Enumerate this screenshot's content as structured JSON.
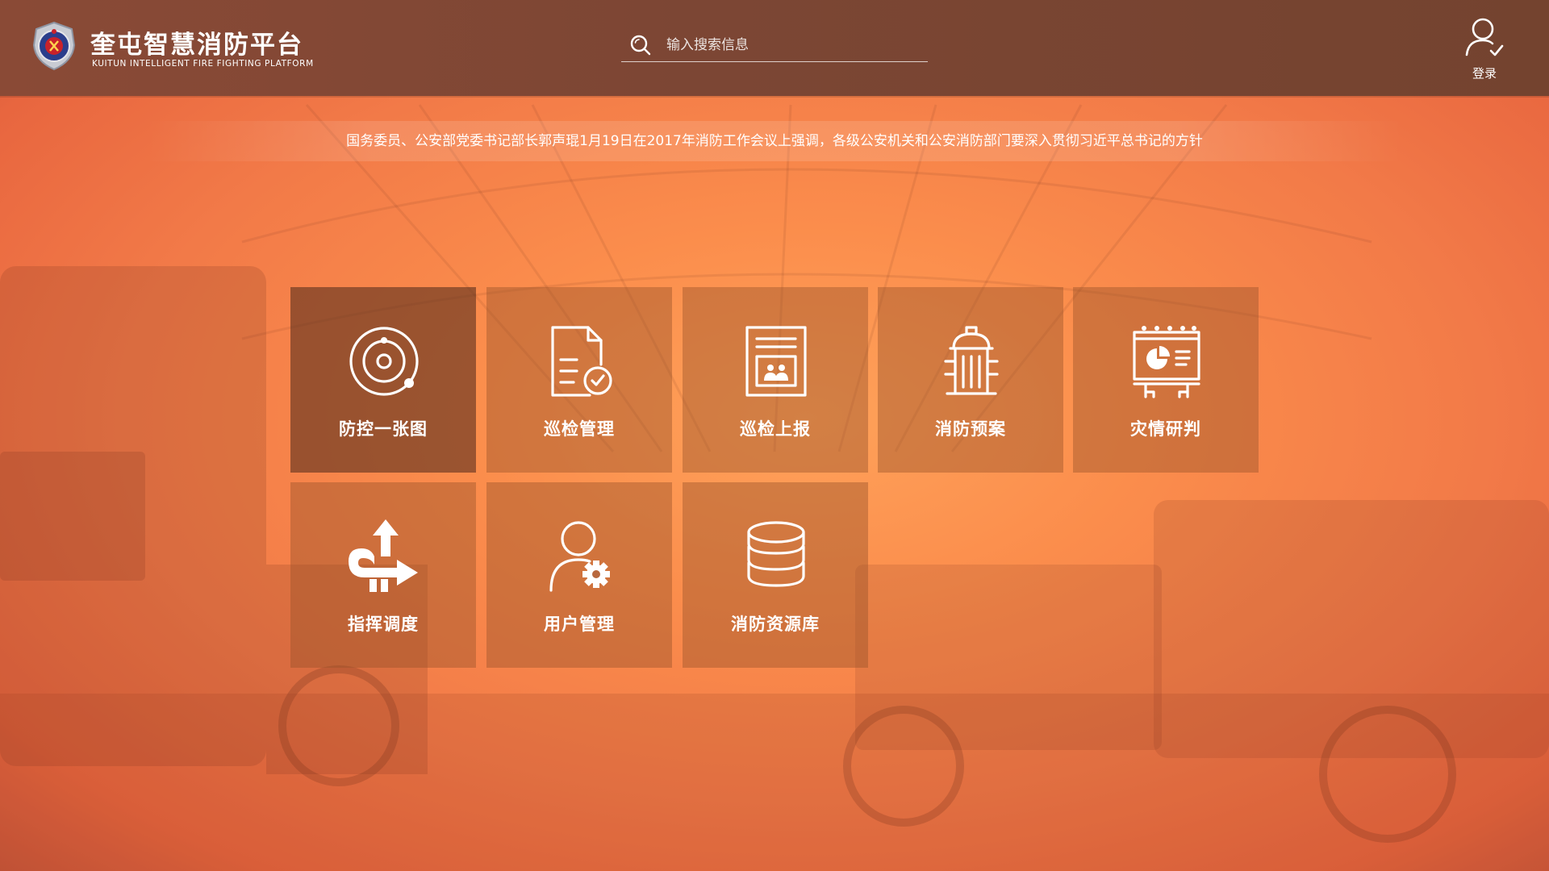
{
  "header": {
    "title": "奎屯智慧消防平台",
    "subtitle": "KUITUN INTELLIGENT FIRE FIGHTING PLATFORM",
    "search_placeholder": "输入搜索信息",
    "login_label": "登录"
  },
  "notice": {
    "text": "国务委员、公安部党委书记部长郭声琨1月19日在2017年消防工作会议上强调，各级公安机关和公安消防部门要深入贯彻习近平总书记的方针"
  },
  "tiles": [
    {
      "label": "防控一张图",
      "icon": "radar-icon",
      "active": true
    },
    {
      "label": "巡检管理",
      "icon": "document-check-icon",
      "active": false
    },
    {
      "label": "巡检上报",
      "icon": "report-frame-icon",
      "active": false
    },
    {
      "label": "消防预案",
      "icon": "fire-hydrant-icon",
      "active": false
    },
    {
      "label": "灾情研判",
      "icon": "analysis-board-icon",
      "active": false
    },
    {
      "label": "指挥调度",
      "icon": "dispatch-arrows-icon",
      "active": false
    },
    {
      "label": "用户管理",
      "icon": "user-gear-icon",
      "active": false
    },
    {
      "label": "消防资源库",
      "icon": "database-icon",
      "active": false
    }
  ],
  "colors": {
    "header_bg": "#7c4634",
    "page_accent": "#fb8d4c",
    "tile_bg": "#965028",
    "text": "#ffffff"
  }
}
